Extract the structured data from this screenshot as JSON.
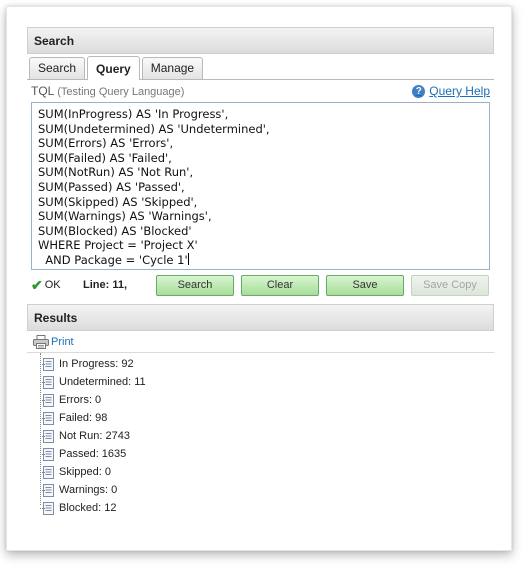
{
  "search_panel": {
    "header": "Search",
    "tabs": [
      {
        "label": "Search",
        "active": false
      },
      {
        "label": "Query",
        "active": true
      },
      {
        "label": "Manage",
        "active": false
      }
    ],
    "tql_title": "TQL",
    "tql_subtitle": "(Testing Query Language)",
    "help_link": "Query Help",
    "query_text": "SUM(InProgress) AS 'In Progress',\nSUM(Undetermined) AS 'Undetermined',\nSUM(Errors) AS 'Errors',\nSUM(Failed) AS 'Failed',\nSUM(NotRun) AS 'Not Run',\nSUM(Passed) AS 'Passed',\nSUM(Skipped) AS 'Skipped',\nSUM(Warnings) AS 'Warnings',\nSUM(Blocked) AS 'Blocked'\nWHERE Project = 'Project X'\n  AND Package = 'Cycle 1'",
    "status": "OK",
    "line_info": "Line: 11,",
    "buttons": {
      "search": "Search",
      "clear": "Clear",
      "save": "Save",
      "save_copy": "Save Copy"
    }
  },
  "results_panel": {
    "header": "Results",
    "print_label": "Print",
    "items": [
      {
        "label": "In Progress: 92"
      },
      {
        "label": "Undetermined: 11"
      },
      {
        "label": "Errors: 0"
      },
      {
        "label": "Failed: 98"
      },
      {
        "label": "Not Run: 2743"
      },
      {
        "label": "Passed: 1635"
      },
      {
        "label": "Skipped: 0"
      },
      {
        "label": "Warnings: 0"
      },
      {
        "label": "Blocked: 12"
      }
    ]
  }
}
